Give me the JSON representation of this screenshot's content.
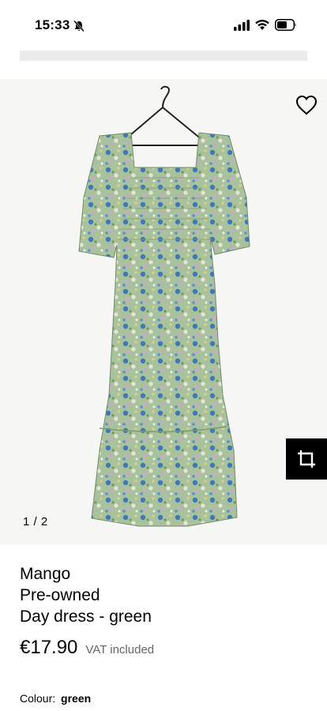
{
  "status_bar": {
    "time": "15:33",
    "icons": [
      "bell-off-icon",
      "signal-icon",
      "wifi-icon",
      "battery-icon"
    ]
  },
  "gallery": {
    "page_indicator": "1 / 2",
    "favorite_icon": "heart-icon",
    "crop_icon": "crop-icon",
    "image_alt": "Floral day dress on hanger"
  },
  "product": {
    "brand": "Mango",
    "condition": "Pre-owned",
    "name": "Day dress - green",
    "price": "€17.90",
    "vat_note": "VAT included",
    "colour_label": "Colour:",
    "colour_value": "green"
  },
  "colors": {
    "background": "#ffffff",
    "placeholder": "#ebebeb",
    "image_bg": "#f6f6f4",
    "crop_button_bg": "#000000",
    "muted_text": "#666666"
  }
}
